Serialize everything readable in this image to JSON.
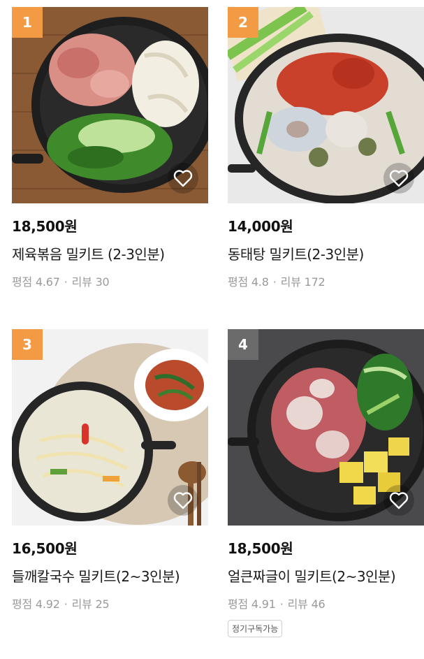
{
  "products": [
    {
      "rank": "1",
      "price": "18,500원",
      "title": "제육볶음 밀키트 (2-3인분)",
      "rating_label": "평점 4.67",
      "review_label": "리뷰 30",
      "badge": ""
    },
    {
      "rank": "2",
      "price": "14,000원",
      "title": "동태탕 밀키트(2-3인분)",
      "rating_label": "평점 4.8",
      "review_label": "리뷰 172",
      "badge": ""
    },
    {
      "rank": "3",
      "price": "16,500원",
      "title": "들깨칼국수 밀키트(2~3인분)",
      "rating_label": "평점 4.92",
      "review_label": "리뷰 25",
      "badge": ""
    },
    {
      "rank": "4",
      "price": "18,500원",
      "title": "얼큰짜글이 밀키트(2~3인분)",
      "rating_label": "평점 4.91",
      "review_label": "리뷰 46",
      "badge": "정기구독가능"
    }
  ],
  "separator": "·",
  "icons": {
    "wishlist": "heart-outline-icon"
  },
  "colors": {
    "rank_top3": "#f39a45",
    "rank_other": "#6b6b6b",
    "meta_text": "#9a9a9a"
  }
}
